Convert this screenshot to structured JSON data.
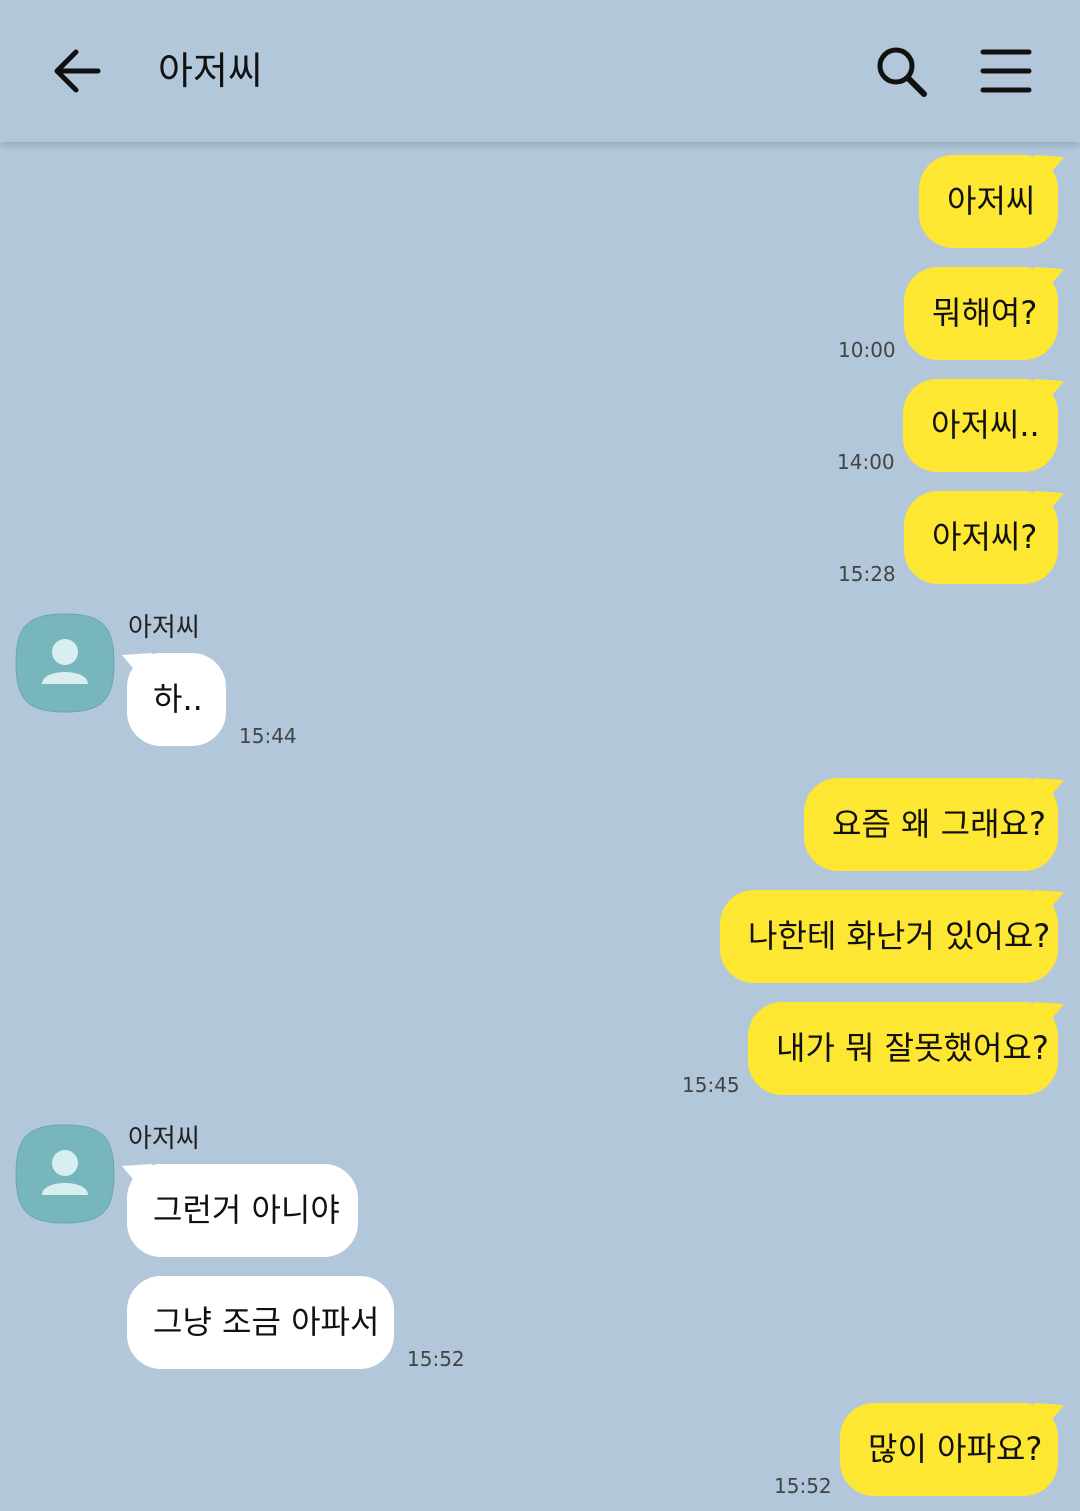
{
  "header": {
    "title": "아저씨"
  },
  "messages": [
    {
      "text": "아저씨"
    },
    {
      "text": "뭐해여?",
      "time": "10:00"
    },
    {
      "text": "아저씨..",
      "time": "14:00"
    },
    {
      "text": "아저씨?",
      "time": "15:28"
    },
    {
      "sender": "아저씨",
      "text": "하..",
      "time": "15:44"
    },
    {
      "text": "요즘 왜 그래요?"
    },
    {
      "text": "나한테 화난거 있어요?"
    },
    {
      "text": "내가 뭐 잘못했어요?",
      "time": "15:45"
    },
    {
      "sender": "아저씨",
      "text": "그런거 아니야"
    },
    {
      "text": "그냥 조금 아파서",
      "time": "15:52"
    },
    {
      "text": "많이 아파요?",
      "time": "15:52"
    }
  ],
  "colors": {
    "background": "#b2c7da",
    "outgoing": "#fee733",
    "incoming": "#ffffff",
    "avatar": "#78b6be"
  }
}
